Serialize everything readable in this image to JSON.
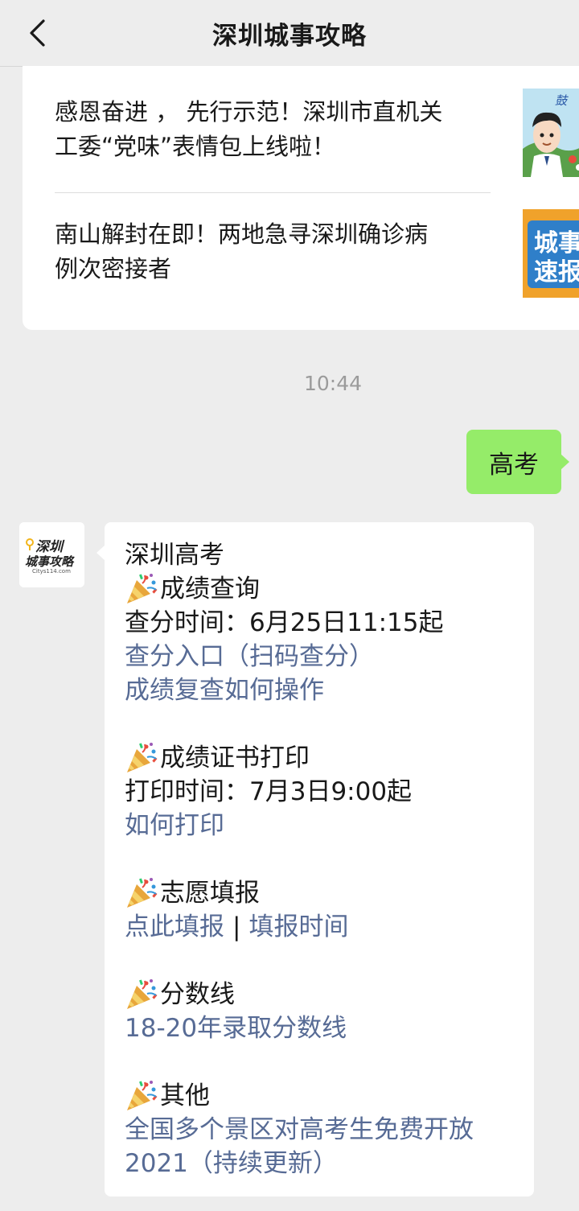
{
  "header": {
    "title": "深圳城事攻略"
  },
  "articles": [
    {
      "title_line1": "感恩奋进 ， 先行示范！深圳市直机关",
      "title_line2": "工委“党味”表情包上线啦！"
    },
    {
      "title_line1": "南山解封在即！两地急寻深圳确诊病",
      "title_line2": "例次密接者",
      "thumb_text_1": "城事",
      "thumb_text_2": "速报"
    }
  ],
  "chat": {
    "timestamp": "10:44",
    "outgoing": {
      "text": "高考"
    },
    "avatar": {
      "line1": "深圳",
      "line2": "城事攻略",
      "site": "Citys114.com"
    },
    "reply": {
      "title": "深圳高考",
      "s1_title": "成绩查询",
      "s1_time": "查分时间：6月25日11:15起",
      "s1_link1": "查分入口（扫码查分）",
      "s1_link2": "成绩复查如何操作",
      "s2_title": "成绩证书打印",
      "s2_time": "打印时间：7月3日9:00起",
      "s2_link1": "如何打印",
      "s3_title": "志愿填报",
      "s3_link1": "点此填报",
      "s3_sep": "|",
      "s3_link2": "填报时间",
      "s4_title": "分数线",
      "s4_link1": "18-20年录取分数线",
      "s5_title": "其他",
      "s5_link1_line1": "全国多个景区对高考生免费开放",
      "s5_link1_line2": "2021（持续更新）"
    }
  },
  "colors": {
    "background": "#ededed",
    "out_bubble": "#95ec69",
    "link": "#576b95",
    "timestamp": "#9b9b9b"
  },
  "icons": [
    "back-arrow-icon",
    "party-popper-icon"
  ]
}
